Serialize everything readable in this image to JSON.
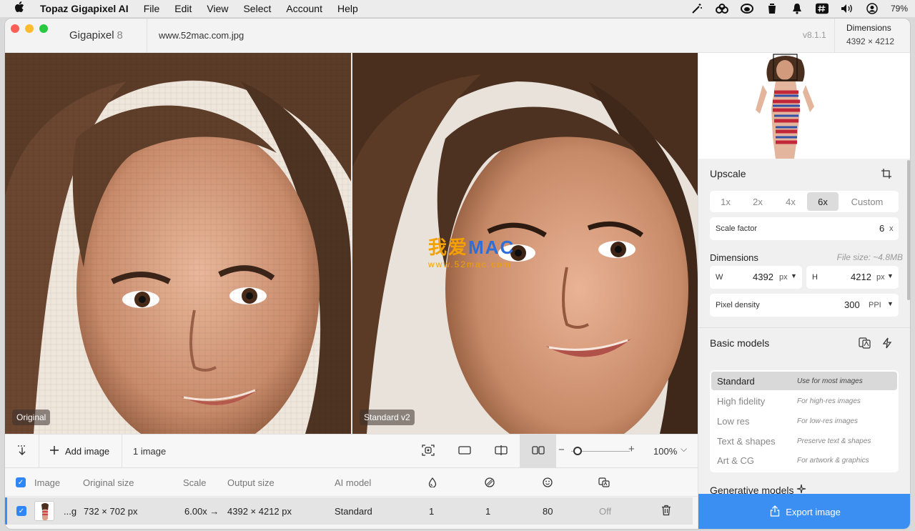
{
  "menubar": {
    "app_name": "Topaz Gigapixel AI",
    "items": [
      "File",
      "Edit",
      "View",
      "Select",
      "Account",
      "Help"
    ],
    "battery": "79%"
  },
  "titlebar": {
    "app": "Gigapixel",
    "app_version_number": "8",
    "filename": "www.52mac.com.jpg",
    "version": "v8.1.1",
    "dimensions_label": "Dimensions",
    "dimensions_value": "4392 × 4212"
  },
  "panes": {
    "left_label": "Original",
    "right_label": "Standard v2"
  },
  "watermark": {
    "main_cn": "我爱",
    "main_en": "MAC",
    "sub": "www.52mac.com"
  },
  "toolbar": {
    "add_image": "Add image",
    "count": "1 image",
    "zoom": "100%"
  },
  "table": {
    "headers": {
      "image": "Image",
      "original_size": "Original size",
      "scale": "Scale",
      "output_size": "Output size",
      "ai_model": "AI model"
    },
    "row": {
      "name": "...g",
      "original_size": "732 × 702 px",
      "scale": "6.00x →",
      "output_size": "4392 × 4212 px",
      "model": "Standard",
      "v1": "1",
      "v2": "1",
      "v3": "80",
      "v4": "Off"
    }
  },
  "side": {
    "upscale_title": "Upscale",
    "scale_options": [
      "1x",
      "2x",
      "4x",
      "6x",
      "Custom"
    ],
    "scale_selected": "6x",
    "scale_factor_label": "Scale factor",
    "scale_factor_value": "6",
    "scale_factor_unit": "x",
    "dimensions_label": "Dimensions",
    "file_size": "File size: ~4.8MB",
    "w_label": "W",
    "w_value": "4392",
    "w_unit": "px",
    "h_label": "H",
    "h_value": "4212",
    "h_unit": "px",
    "density_label": "Pixel density",
    "density_value": "300",
    "density_unit": "PPI",
    "basic_models_title": "Basic models",
    "models": [
      {
        "name": "Standard",
        "desc": "Use for most images"
      },
      {
        "name": "High fidelity",
        "desc": "For high-res images"
      },
      {
        "name": "Low res",
        "desc": "For low-res images"
      },
      {
        "name": "Text & shapes",
        "desc": "Preserve text & shapes"
      },
      {
        "name": "Art & CG",
        "desc": "For artwork & graphics"
      }
    ],
    "generative_title": "Generative models",
    "export": "Export image"
  },
  "colors": {
    "accent": "#3b8ff3",
    "watermark_orange": "#f3a000",
    "watermark_blue": "#2e6ed8"
  }
}
